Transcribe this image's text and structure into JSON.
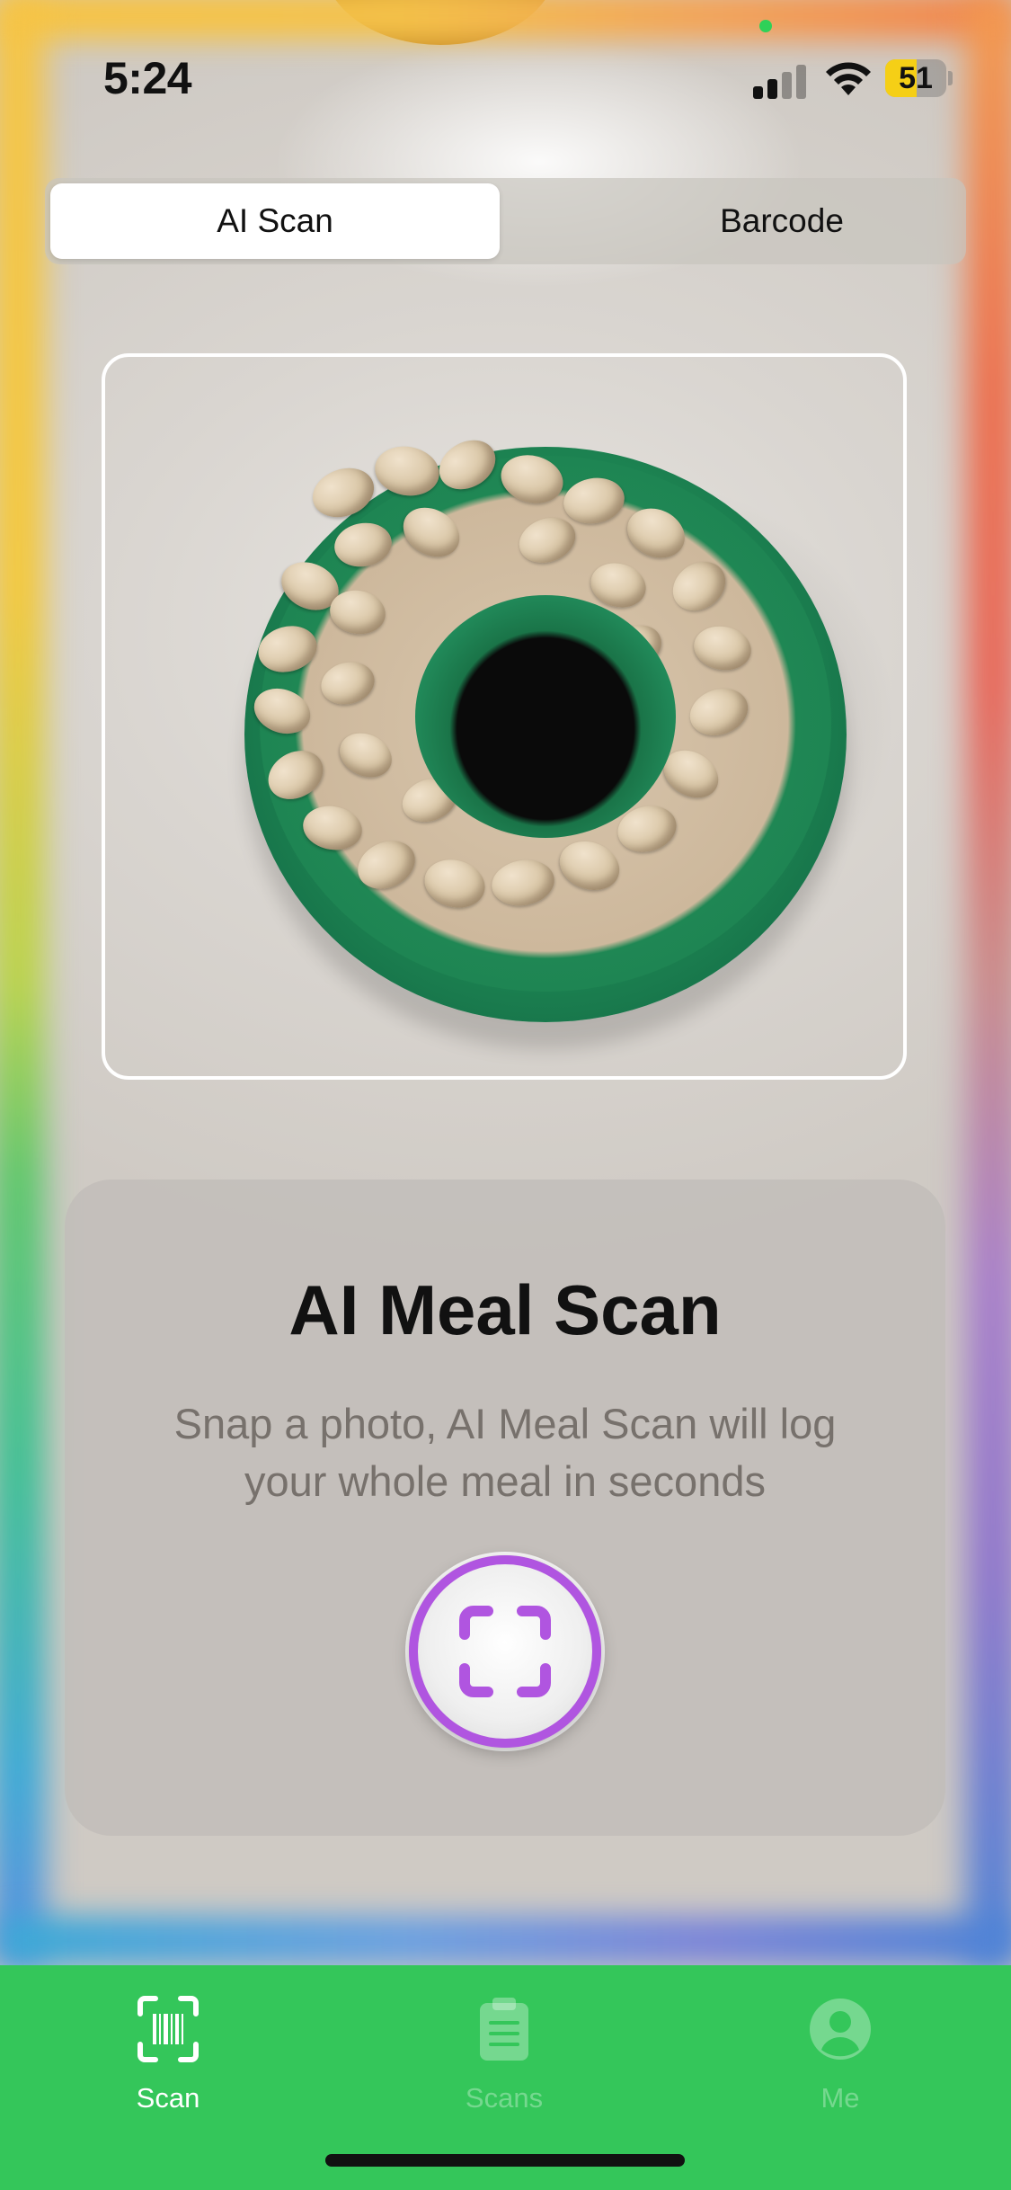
{
  "status_bar": {
    "time": "5:24",
    "battery_level": "51",
    "battery_fraction": 0.51
  },
  "segmented_control": {
    "options": [
      "AI Scan",
      "Barcode"
    ],
    "selected": "AI Scan"
  },
  "info_card": {
    "title": "AI Meal Scan",
    "description": "Snap a photo, AI Meal Scan will log your whole meal in seconds"
  },
  "shutter": {
    "icon": "scan-frame-icon",
    "accent_color": "#b055e0"
  },
  "tab_bar": {
    "background_color": "#34c65a",
    "tabs": [
      {
        "label": "Scan",
        "icon": "barcode-scan-icon",
        "active": true
      },
      {
        "label": "Scans",
        "icon": "clipboard-icon",
        "active": false
      },
      {
        "label": "Me",
        "icon": "person-icon",
        "active": false
      }
    ]
  },
  "colors": {
    "accent_purple": "#b055e0",
    "tab_green": "#34c65a",
    "battery_yellow": "#f5cf16"
  }
}
